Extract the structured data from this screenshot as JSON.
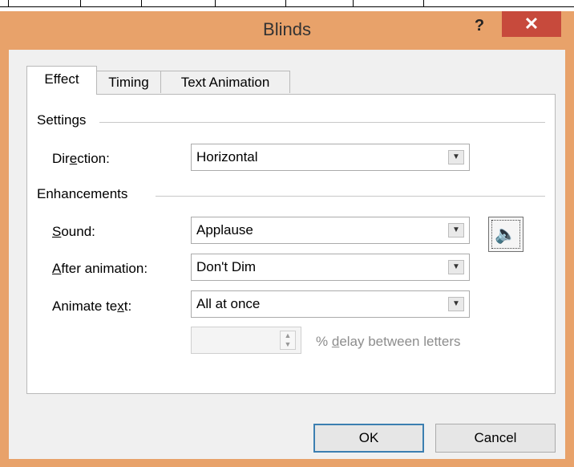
{
  "dialog": {
    "title": "Blinds",
    "help_glyph": "?",
    "close_glyph": "✕"
  },
  "tabs": [
    {
      "label": "Effect",
      "active": true
    },
    {
      "label": "Timing",
      "active": false
    },
    {
      "label": "Text Animation",
      "active": false
    }
  ],
  "settings": {
    "group_title": "Settings",
    "direction": {
      "label_pre": "Dir",
      "label_u": "e",
      "label_post": "ction:",
      "value": "Horizontal"
    }
  },
  "enhancements": {
    "group_title": "Enhancements",
    "sound": {
      "label_pre": "",
      "label_u": "S",
      "label_post": "ound:",
      "value": "Applause"
    },
    "after_animation": {
      "label_pre": "",
      "label_u": "A",
      "label_post": "fter animation:",
      "value": "Don't Dim"
    },
    "animate_text": {
      "label_pre": "Animate te",
      "label_u": "x",
      "label_post": "t:",
      "value": "All at once"
    },
    "delay": {
      "value": "",
      "label_pre": "% ",
      "label_u": "d",
      "label_post": "elay between letters"
    }
  },
  "buttons": {
    "ok": "OK",
    "cancel": "Cancel"
  },
  "icons": {
    "dropdown": "chevron-down-icon",
    "sound": "speaker-icon",
    "spin": "spinner-arrows-icon"
  }
}
